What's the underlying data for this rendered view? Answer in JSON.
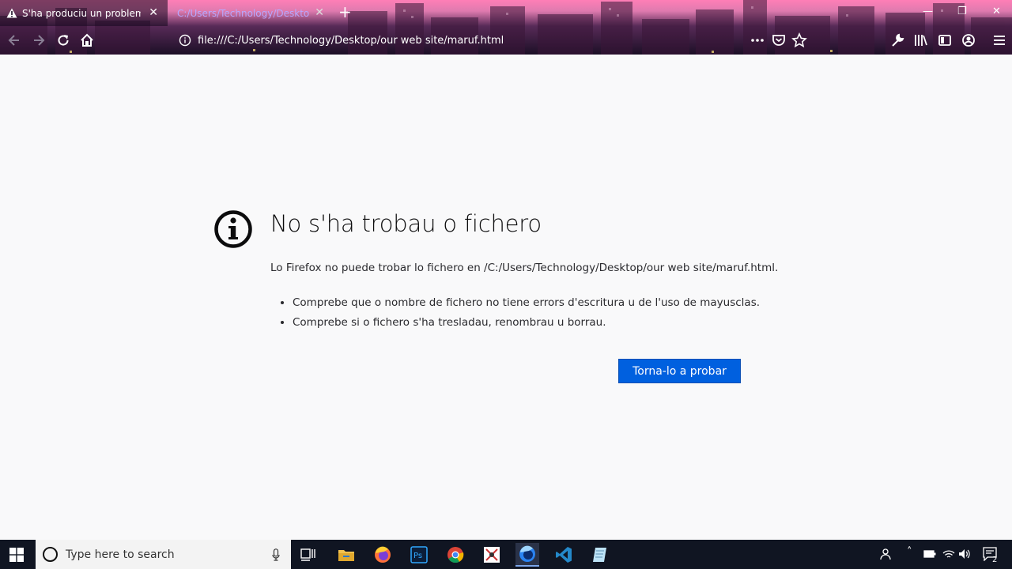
{
  "tabs": [
    {
      "title": "S'ha produciu un problema en",
      "active": true
    },
    {
      "title": "C:/Users/Technology/Desktop/ou",
      "active": false
    }
  ],
  "icons": {
    "tab_warning": "warning-icon",
    "close": "close-icon",
    "new_tab": "plus-icon",
    "back": "back-arrow-icon",
    "forward": "forward-arrow-icon",
    "reload": "reload-icon",
    "home": "home-icon",
    "info": "info-icon",
    "more": "more-icon",
    "pocket": "pocket-icon",
    "bookmark": "star-icon",
    "wrench": "wrench-icon",
    "library": "library-icon",
    "sidebar": "sidebar-icon",
    "account": "account-icon",
    "menu": "hamburger-menu-icon"
  },
  "address_bar": {
    "url": "file:///C:/Users/Technology/Desktop/our web site/maruf.html"
  },
  "error": {
    "title": "No s'ha trobau o fichero",
    "description": "Lo Firefox no puede trobar lo fichero en /C:/Users/Technology/Desktop/our web site/maruf.html.",
    "suggestions": [
      "Comprebe que o nombre de fichero no tiene errors d'escritura u de l'uso de mayusclas.",
      "Comprebe si o fichero s'ha tresladau, renombrau u borrau."
    ],
    "retry_label": "Torna-lo a probar"
  },
  "taskbar": {
    "search_placeholder": "Type here to search",
    "apps": [
      "task-view",
      "file-explorer",
      "firefox",
      "photoshop",
      "chrome",
      "snipping-tool",
      "firefox-developer",
      "vscode",
      "notepad"
    ],
    "notification_count": "2"
  },
  "colors": {
    "accent_button": "#0060df",
    "page_background": "#f9f9fa",
    "taskbar": "#101522"
  }
}
